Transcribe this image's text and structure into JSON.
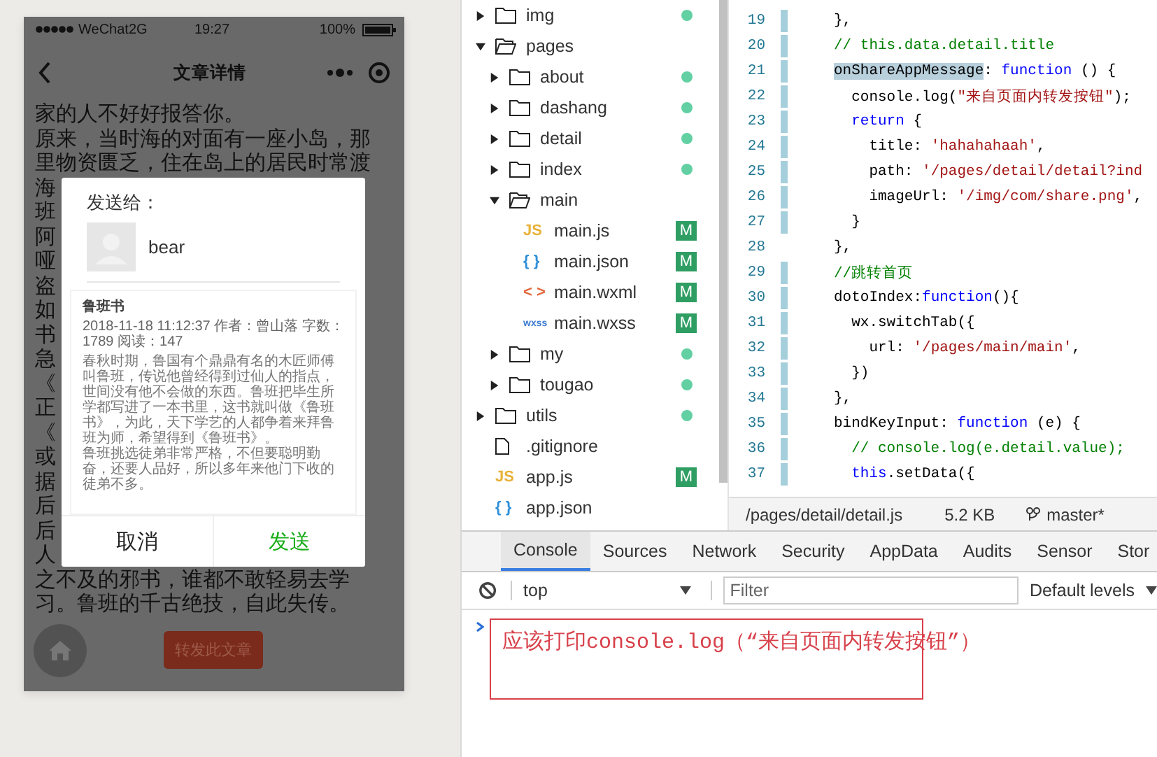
{
  "simulator": {
    "status_bar": {
      "carrier": "WeChat2G",
      "time": "19:27",
      "battery": "100%"
    },
    "nav": {
      "title": "文章详情"
    },
    "article_lines": [
      "家的人不好好报答你。",
      "原来，当时海的对面有一座小岛，那",
      "里物资匮乏，住在岛上的居民时常渡",
      "海",
      "班",
      "阿",
      "哑",
      "盗",
      "如",
      "书",
      "急",
      "《",
      "正",
      "《",
      "或",
      "据",
      "后",
      "后",
      "人",
      "之不及的邪书，谁都不敢轻易去学",
      "习。鲁班的千古绝技，自此失传。"
    ],
    "share_dialog": {
      "heading": "发送给：",
      "recipient": "bear",
      "preview": {
        "title": "鲁班书",
        "meta": "2018-11-18 11:12:37 作者：曾山落 字数：1789 阅读：147",
        "paragraphs": [
          "春秋时期，鲁国有个鼎鼎有名的木匠师傅叫鲁班，传说他曾经得到过仙人的指点，世间没有他不会做的东西。鲁班把毕生所学都写进了一本书里，这书就叫做《鲁班书》，为此，天下学艺的人都争着来拜鲁班为师，希望得到《鲁班书》。",
          "鲁班挑选徒弟非常严格，不但要聪明勤奋，还要人品好，所以多年来他门下收的徒弟不多。"
        ]
      },
      "buttons": [
        {
          "label": "取消",
          "kind": "cancel"
        },
        {
          "label": "发送",
          "kind": "confirm"
        }
      ]
    },
    "forward_button": "转发此文章"
  },
  "file_tree": [
    {
      "name": "img",
      "kind": "folder",
      "expanded": false,
      "dot": true
    },
    {
      "name": "pages",
      "kind": "folder",
      "expanded": true,
      "dot": false,
      "children": [
        {
          "name": "about",
          "kind": "folder",
          "expanded": false,
          "dot": true
        },
        {
          "name": "dashang",
          "kind": "folder",
          "expanded": false,
          "dot": true
        },
        {
          "name": "detail",
          "kind": "folder",
          "expanded": false,
          "dot": true
        },
        {
          "name": "index",
          "kind": "folder",
          "expanded": false,
          "dot": true
        },
        {
          "name": "main",
          "kind": "folder",
          "expanded": true,
          "dot": false,
          "children": [
            {
              "name": "main.js",
              "kind": "js",
              "icon_text": "JS",
              "badge": "M"
            },
            {
              "name": "main.json",
              "kind": "json",
              "icon_text": "{ }",
              "badge": "M"
            },
            {
              "name": "main.wxml",
              "kind": "wxml",
              "icon_text": "< >",
              "badge": "M"
            },
            {
              "name": "main.wxss",
              "kind": "wxss",
              "icon_text": "wxss",
              "badge": "M"
            }
          ]
        },
        {
          "name": "my",
          "kind": "folder",
          "expanded": false,
          "dot": true
        },
        {
          "name": "tougao",
          "kind": "folder",
          "expanded": false,
          "dot": true
        }
      ]
    },
    {
      "name": "utils",
      "kind": "folder",
      "expanded": false,
      "dot": true
    },
    {
      "name": ".gitignore",
      "kind": "file",
      "dot": false
    },
    {
      "name": "app.js",
      "kind": "js",
      "icon_text": "JS",
      "badge": "M"
    },
    {
      "name": "app.json",
      "kind": "json",
      "icon_text": "{ }",
      "dot": false
    }
  ],
  "editor": {
    "lines": [
      {
        "number": "19",
        "changed": true,
        "tokens": [
          {
            "text": "},",
            "kind": "plain"
          }
        ]
      },
      {
        "number": "20",
        "changed": true,
        "tokens": [
          {
            "text": "// this.data.detail.title",
            "kind": "comment"
          }
        ]
      },
      {
        "number": "21",
        "changed": true,
        "tokens": [
          {
            "text": "onShareAppMessage",
            "kind": "highlight"
          },
          {
            "text": ": ",
            "kind": "plain"
          },
          {
            "text": "function",
            "kind": "keyword"
          },
          {
            "text": " () {",
            "kind": "plain"
          }
        ]
      },
      {
        "number": "22",
        "changed": true,
        "tokens": [
          {
            "text": "  console.log(",
            "kind": "plain"
          },
          {
            "text": "\"来自页面内转发按钮\"",
            "kind": "string"
          },
          {
            "text": ");",
            "kind": "plain"
          }
        ]
      },
      {
        "number": "23",
        "changed": true,
        "tokens": [
          {
            "text": "  return",
            "kind": "keyword"
          },
          {
            "text": " {",
            "kind": "plain"
          }
        ]
      },
      {
        "number": "24",
        "changed": true,
        "tokens": [
          {
            "text": "    title: ",
            "kind": "plain"
          },
          {
            "text": "'hahahahaah'",
            "kind": "string"
          },
          {
            "text": ",",
            "kind": "plain"
          }
        ]
      },
      {
        "number": "25",
        "changed": true,
        "tokens": [
          {
            "text": "    path: ",
            "kind": "plain"
          },
          {
            "text": "'/pages/detail/detail?ind",
            "kind": "string"
          }
        ]
      },
      {
        "number": "26",
        "changed": true,
        "tokens": [
          {
            "text": "    imageUrl: ",
            "kind": "plain"
          },
          {
            "text": "'/img/com/share.png'",
            "kind": "string"
          },
          {
            "text": ",",
            "kind": "plain"
          }
        ]
      },
      {
        "number": "27",
        "changed": true,
        "tokens": [
          {
            "text": "  }",
            "kind": "plain"
          }
        ]
      },
      {
        "number": "28",
        "changed": false,
        "tokens": [
          {
            "text": "},",
            "kind": "plain"
          }
        ]
      },
      {
        "number": "29",
        "changed": true,
        "tokens": [
          {
            "text": "//跳转首页",
            "kind": "comment"
          }
        ]
      },
      {
        "number": "30",
        "changed": true,
        "tokens": [
          {
            "text": "dotoIndex:",
            "kind": "plain"
          },
          {
            "text": "function",
            "kind": "keyword"
          },
          {
            "text": "(){",
            "kind": "plain"
          }
        ]
      },
      {
        "number": "31",
        "changed": true,
        "tokens": [
          {
            "text": "  wx.switchTab({",
            "kind": "plain"
          }
        ]
      },
      {
        "number": "32",
        "changed": true,
        "tokens": [
          {
            "text": "    url: ",
            "kind": "plain"
          },
          {
            "text": "'/pages/main/main'",
            "kind": "string"
          },
          {
            "text": ",",
            "kind": "plain"
          }
        ]
      },
      {
        "number": "33",
        "changed": true,
        "tokens": [
          {
            "text": "  })",
            "kind": "plain"
          }
        ]
      },
      {
        "number": "34",
        "changed": true,
        "tokens": [
          {
            "text": "},",
            "kind": "plain"
          }
        ]
      },
      {
        "number": "35",
        "changed": true,
        "tokens": [
          {
            "text": "bindKeyInput: ",
            "kind": "plain"
          },
          {
            "text": "function",
            "kind": "keyword"
          },
          {
            "text": " (e) {",
            "kind": "plain"
          }
        ]
      },
      {
        "number": "36",
        "changed": true,
        "tokens": [
          {
            "text": "  // console.log(e.detail.value);",
            "kind": "comment"
          }
        ]
      },
      {
        "number": "37",
        "changed": true,
        "tokens": [
          {
            "text": "  this",
            "kind": "keyword"
          },
          {
            "text": ".setData({",
            "kind": "plain"
          }
        ]
      }
    ],
    "status_bar": {
      "path": "/pages/detail/detail.js",
      "size": "5.2 KB",
      "branch": "master*"
    }
  },
  "devtools": {
    "tabs": [
      {
        "label": "Console",
        "selected": true
      },
      {
        "label": "Sources",
        "selected": false
      },
      {
        "label": "Network",
        "selected": false
      },
      {
        "label": "Security",
        "selected": false
      },
      {
        "label": "AppData",
        "selected": false
      },
      {
        "label": "Audits",
        "selected": false
      },
      {
        "label": "Sensor",
        "selected": false
      },
      {
        "label": "Stor",
        "selected": false
      }
    ],
    "context": "top",
    "filter": {
      "placeholder": "Filter"
    },
    "levels": "Default levels",
    "annotation": "应该打印console.log（“来自页面内转发按钮”）"
  }
}
